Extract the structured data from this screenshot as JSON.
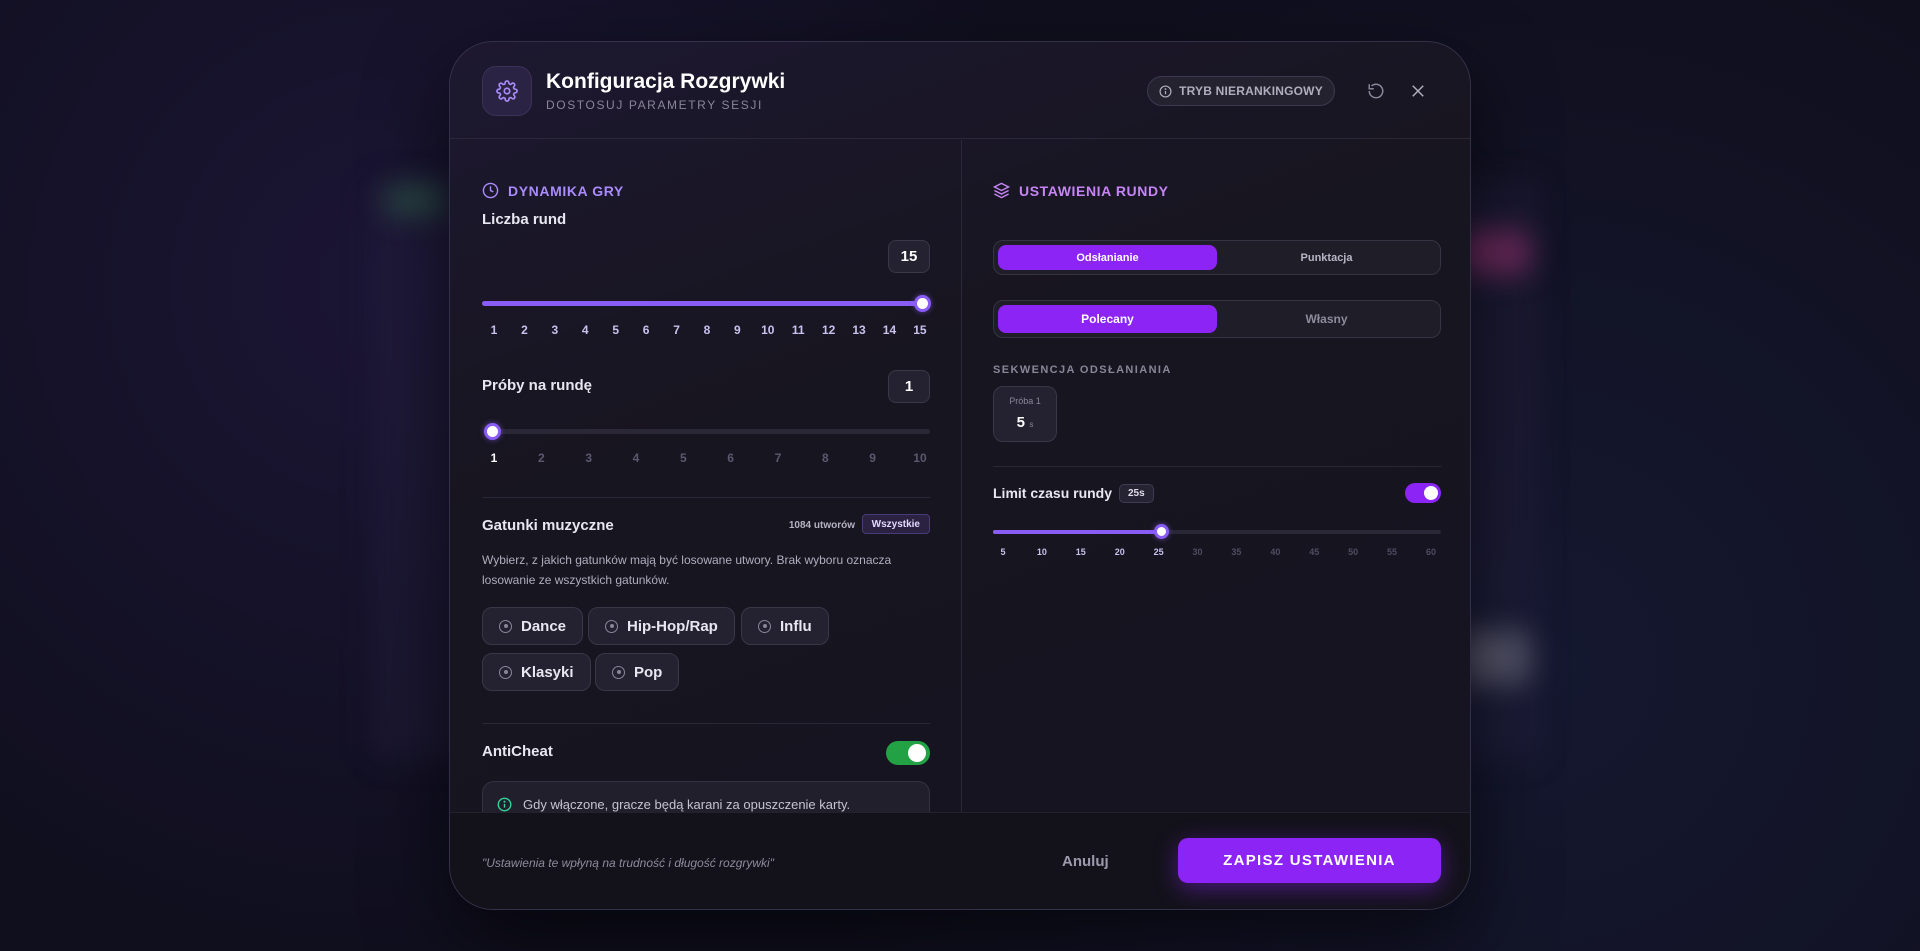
{
  "header": {
    "title": "Konfiguracja Rozgrywki",
    "subtitle": "DOSTOSUJ PARAMETRY SESJI",
    "mode_badge": "TRYB NIERANKINGOWY"
  },
  "left": {
    "section_title": "DYNAMIKA GRY",
    "rounds": {
      "label": "Liczba rund",
      "value": "15",
      "ticks": [
        "1",
        "2",
        "3",
        "4",
        "5",
        "6",
        "7",
        "8",
        "9",
        "10",
        "11",
        "12",
        "13",
        "14",
        "15"
      ],
      "fraction": 1.0
    },
    "attempts": {
      "label": "Próby na rundę",
      "value": "1",
      "ticks": [
        "1",
        "2",
        "3",
        "4",
        "5",
        "6",
        "7",
        "8",
        "9",
        "10"
      ],
      "fraction": 0.0
    },
    "genres": {
      "label": "Gatunki muzyczne",
      "count": "1084 utworów",
      "all_badge": "Wszystkie",
      "description": "Wybierz, z jakich gatunków mają być losowane utwory. Brak wyboru oznacza losowanie ze wszystkich gatunków.",
      "items": [
        "Dance",
        "Hip-Hop/Rap",
        "Influ",
        "Klasyki",
        "Pop"
      ]
    },
    "anticheat": {
      "label": "AntiCheat",
      "enabled": true,
      "info": "Gdy włączone, gracze będą karani za opuszczenie karty."
    }
  },
  "right": {
    "section_title": "USTAWIENIA RUNDY",
    "tabs": [
      "Odsłanianie",
      "Punktacja"
    ],
    "mode_options": [
      "Polecany",
      "Własny"
    ],
    "sequence": {
      "label": "SEKWENCJA ODSŁANIANIA",
      "card_label": "Próba 1",
      "card_value": "5",
      "card_unit": "s"
    },
    "time_limit": {
      "label": "Limit czasu rundy",
      "badge": "25s",
      "enabled": true,
      "ticks": [
        "5",
        "10",
        "15",
        "20",
        "25",
        "30",
        "35",
        "40",
        "45",
        "50",
        "55",
        "60"
      ],
      "value": 25
    }
  },
  "footer": {
    "note": "\"Ustawienia te wpłyną na trudność i długość rozgrywki\"",
    "cancel": "Anuluj",
    "save": "ZAPISZ USTAWIENIA"
  },
  "colors": {
    "accent": "#8b24f5",
    "slider": "#8a5cf6",
    "section_left": "#a98bfa",
    "section_right": "#c685f5",
    "toggle_green": "#22a244"
  }
}
